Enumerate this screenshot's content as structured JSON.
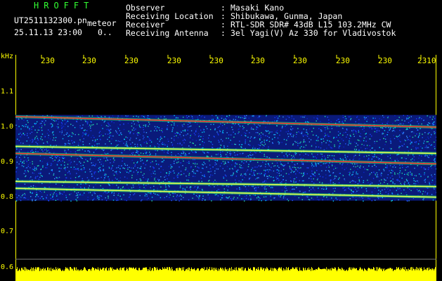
{
  "header": {
    "brand": "HROFFT",
    "filename": "UT2511132300.pn",
    "mode": "meteor",
    "datetime": "25.11.13 23:00",
    "counter": "0..",
    "fields": [
      {
        "key": "Observer",
        "value": "Masaki Kano"
      },
      {
        "key": "Receiving Location",
        "value": "Shibukawa, Gunma, Japan"
      },
      {
        "key": "Receiver",
        "value": "RTL-SDR SDR# 43dB L15 103.2MHz CW"
      },
      {
        "key": "Receiving Antenna",
        "value": "3el Yagi(V) Az 330 for Vladivostok"
      }
    ]
  },
  "axis": {
    "unit": "kHz",
    "x_ticks": [
      "230",
      "230",
      "230",
      "230",
      "230",
      "230",
      "230",
      "230",
      "230",
      "2310"
    ],
    "y_ticks": [
      "1.1",
      "1.0",
      "0.9",
      "0.8",
      "0.7",
      "0.6"
    ]
  },
  "colors": {
    "background": "#000000",
    "axis_text": "#ffff00",
    "brand": "#33ff33",
    "noise": "#1a3cff",
    "signal": "#ff3333",
    "level": "#ffff00"
  },
  "spectrogram": {
    "freq_range_khz": [
      0.6,
      1.15
    ],
    "traces_khz_start_end": [
      [
        1.03,
        1.0
      ],
      [
        0.925,
        0.895
      ],
      [
        0.945,
        0.925
      ],
      [
        0.845,
        0.83
      ],
      [
        0.825,
        0.8
      ]
    ]
  }
}
